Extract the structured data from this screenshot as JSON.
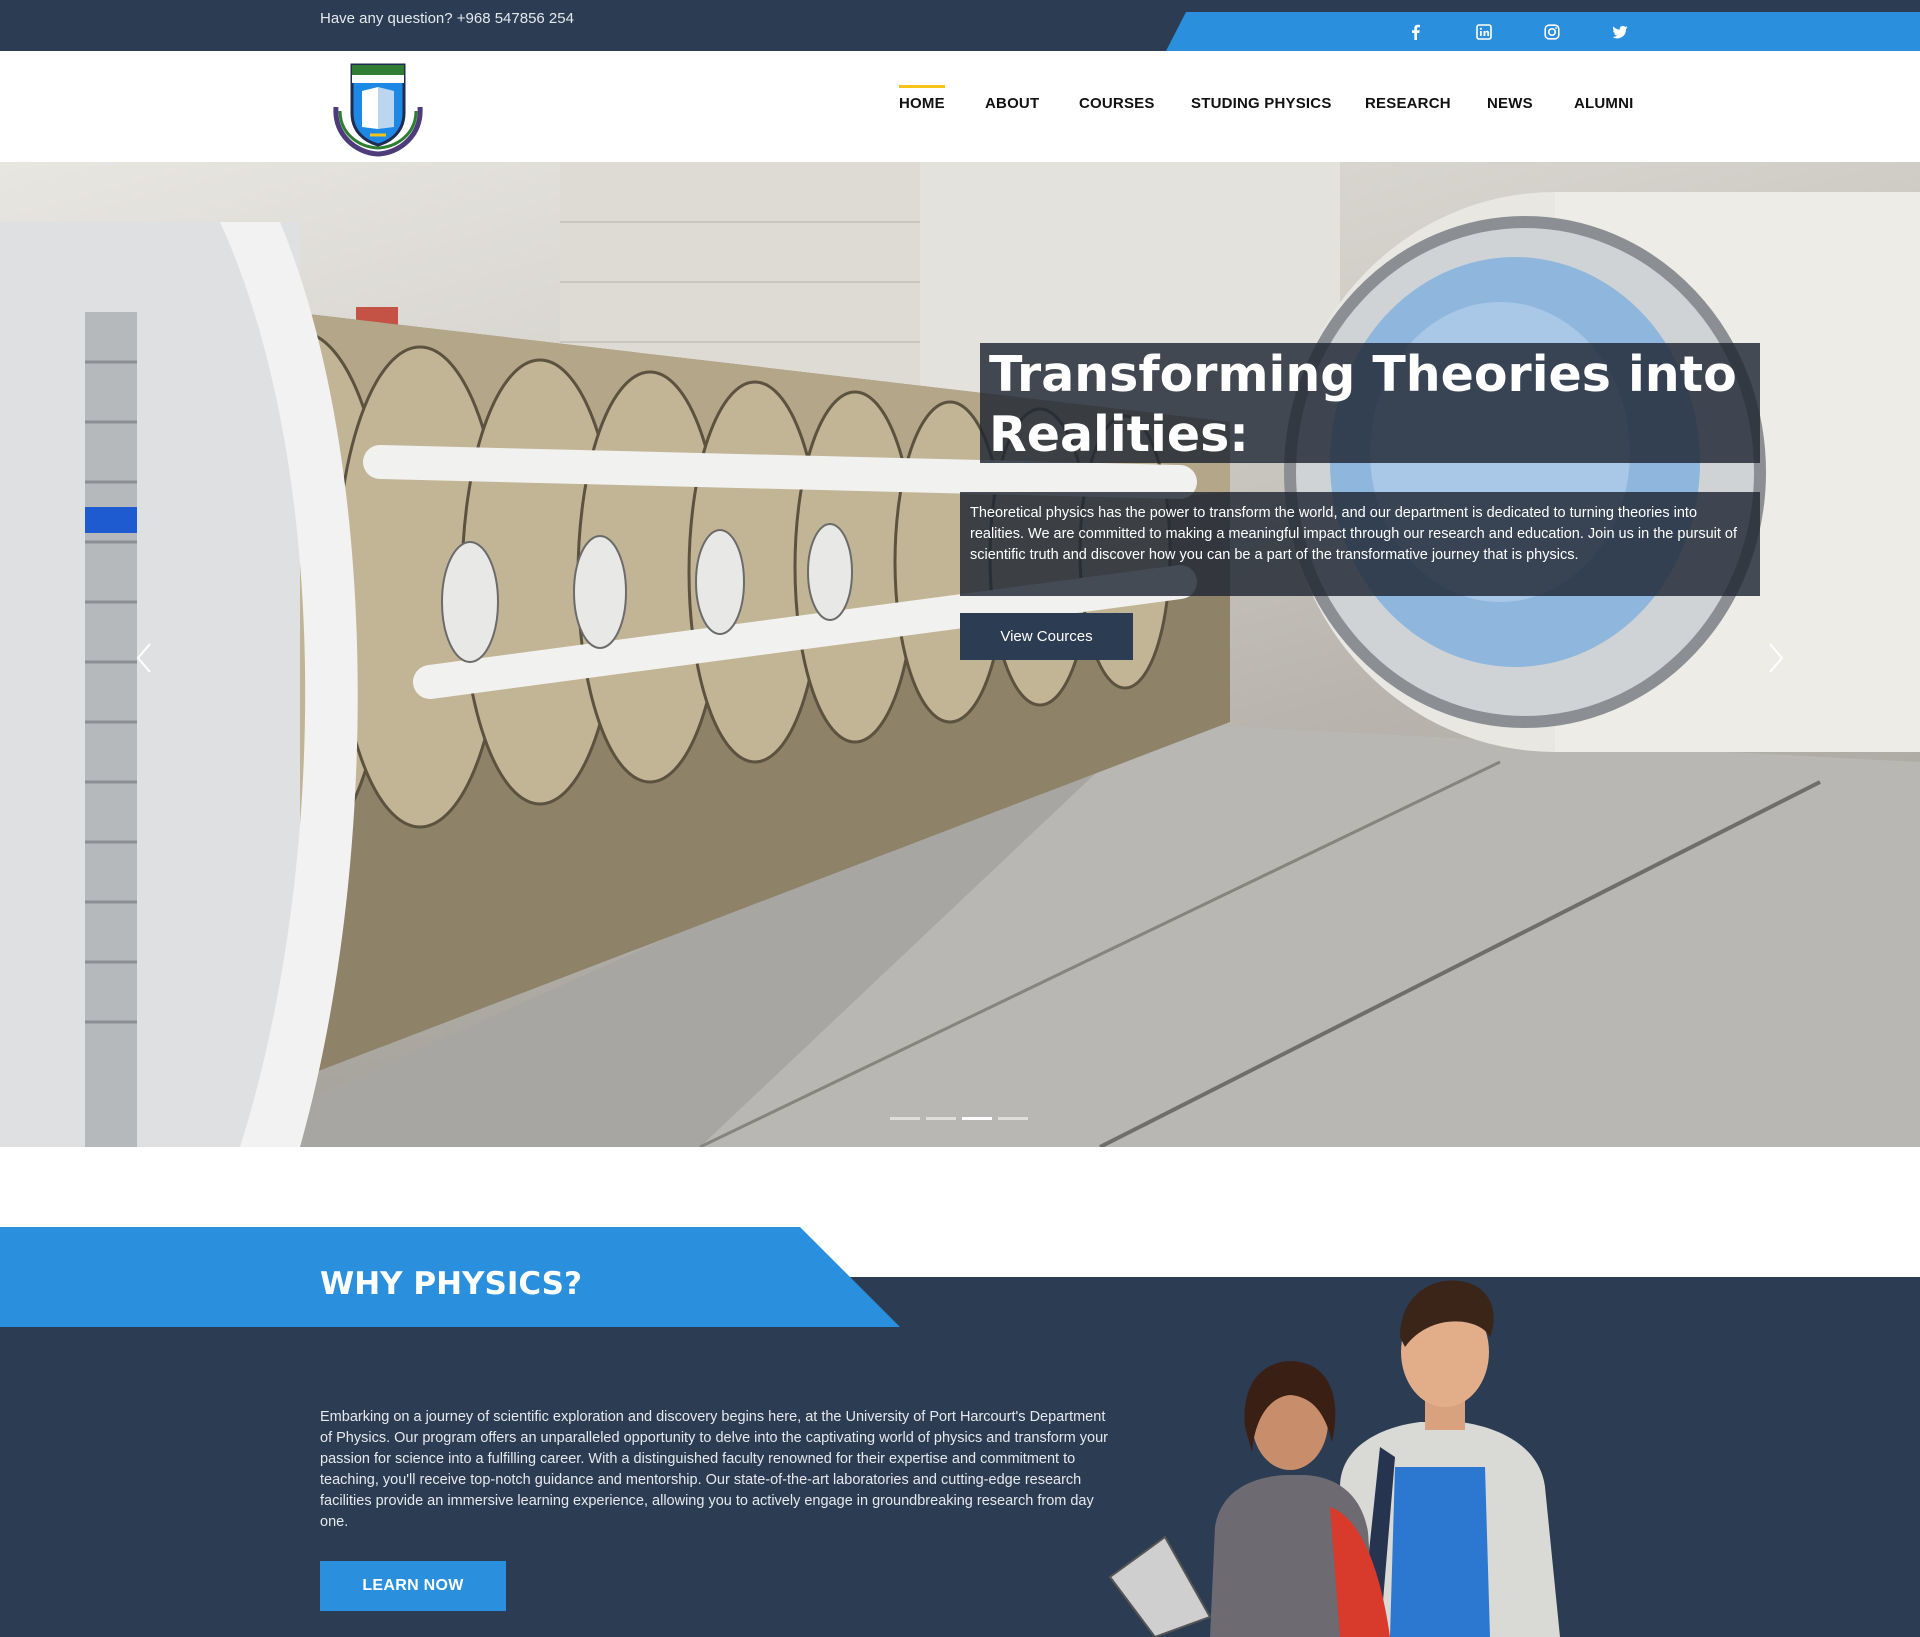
{
  "topbar": {
    "question": "Have any question? +968 547856 254",
    "social": [
      "facebook-icon",
      "linkedin-icon",
      "instagram-icon",
      "twitter-icon"
    ]
  },
  "nav": {
    "items": [
      "HOME",
      "ABOUT",
      "COURSES",
      "STUDING PHYSICS",
      "RESEARCH",
      "NEWS",
      "ALUMNI"
    ],
    "active": "HOME"
  },
  "hero": {
    "title": "Transforming Theories into Realities:",
    "description": "Theoretical physics has the power to transform the world, and our department is dedicated to turning theories into realities. We are committed to making a meaningful impact through our research and education. Join us in the pursuit of scientific truth and discover how you can be a part of the transformative journey that is physics.",
    "button": "View Cources",
    "slides_total": 4,
    "slide_active": 3
  },
  "why": {
    "title": "WHY PHYSICS?",
    "text": "Embarking on a journey of scientific exploration and discovery begins here, at the University of Port Harcourt's Department of Physics. Our program offers an unparalleled opportunity to delve into the captivating world of physics and transform your passion for science into a fulfilling career. With a distinguished faculty renowned for their expertise and commitment to teaching, you'll receive top-notch guidance and mentorship. Our state-of-the-art laboratories and cutting-edge research facilities provide an immersive learning experience, allowing you to actively engage in groundbreaking research from day one.",
    "button": "LEARN NOW"
  },
  "colors": {
    "navy": "#2c3c52",
    "blue": "#2a8fdc",
    "accent": "#f5c417"
  }
}
